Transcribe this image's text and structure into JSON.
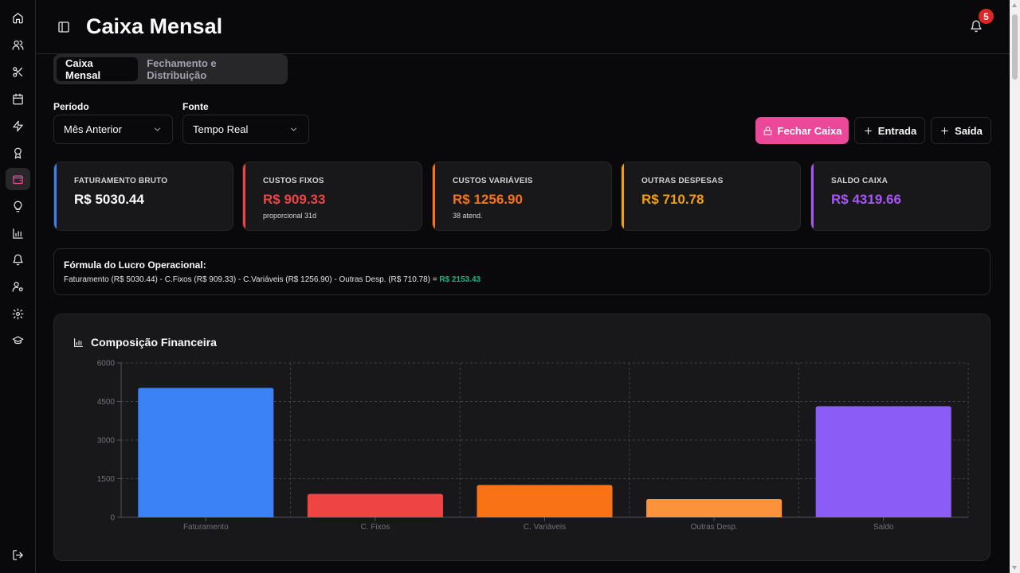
{
  "header": {
    "title": "Caixa Mensal",
    "notification_count": "5"
  },
  "sidebar": {
    "items": [
      {
        "icon": "home-icon"
      },
      {
        "icon": "users-icon"
      },
      {
        "icon": "scissors-icon"
      },
      {
        "icon": "calendar-icon"
      },
      {
        "icon": "zap-icon"
      },
      {
        "icon": "award-icon"
      },
      {
        "icon": "wallet-icon",
        "active": true
      },
      {
        "icon": "lightbulb-icon"
      },
      {
        "icon": "bar-chart-icon"
      },
      {
        "icon": "bell-icon"
      },
      {
        "icon": "user-cog-icon"
      },
      {
        "icon": "settings-icon"
      },
      {
        "icon": "graduation-cap-icon"
      },
      {
        "icon": "logout-icon"
      }
    ]
  },
  "tabs": [
    {
      "label": "Caixa Mensal",
      "active": true
    },
    {
      "label": "Fechamento e Distribuição",
      "active": false
    }
  ],
  "filters": {
    "period_label": "Período",
    "period_value": "Mês Anterior",
    "source_label": "Fonte",
    "source_value": "Tempo Real"
  },
  "actions": {
    "close_label": "Fechar Caixa",
    "entry_label": "Entrada",
    "exit_label": "Saída"
  },
  "kpis": [
    {
      "label": "FATURAMENTO BRUTO",
      "value": "R$ 5030.44",
      "sub": "",
      "color": "#3b82f6",
      "value_color": "#fafafa"
    },
    {
      "label": "CUSTOS FIXOS",
      "value": "R$ 909.33",
      "sub": "proporcional 31d",
      "color": "#ef4444",
      "value_color": "#ef4444"
    },
    {
      "label": "CUSTOS VARIÁVEIS",
      "value": "R$ 1256.90",
      "sub": "38 atend.",
      "color": "#f97316",
      "value_color": "#f97316"
    },
    {
      "label": "OUTRAS DESPESAS",
      "value": "R$ 710.78",
      "sub": "",
      "color": "#f59e0b",
      "value_color": "#f59e0b"
    },
    {
      "label": "SALDO CAIXA",
      "value": "R$ 4319.66",
      "sub": "",
      "color": "#a855f7",
      "value_color": "#a855f7"
    }
  ],
  "formula": {
    "title": "Fórmula do Lucro Operacional:",
    "text": "Faturamento (R$ 5030.44) - C.Fixos (R$ 909.33) - C.Variáveis (R$ 1256.90) - Outras Desp. (R$ 710.78) = ",
    "result": "R$ 2153.43"
  },
  "chart_card": {
    "title": "Composição Financeira"
  },
  "chart_data": {
    "type": "bar",
    "categories": [
      "Faturamento",
      "C. Fixos",
      "C. Variáveis",
      "Outras Desp.",
      "Saldo"
    ],
    "values": [
      5030.44,
      909.33,
      1256.9,
      710.78,
      4319.66
    ],
    "colors": [
      "#3b82f6",
      "#ef4444",
      "#f97316",
      "#fb923c",
      "#8b5cf6"
    ],
    "ylim": [
      0,
      6000
    ],
    "yticks": [
      0,
      1500,
      3000,
      4500,
      6000
    ],
    "title": "",
    "xlabel": "",
    "ylabel": "",
    "grid": true,
    "legend": "none"
  }
}
